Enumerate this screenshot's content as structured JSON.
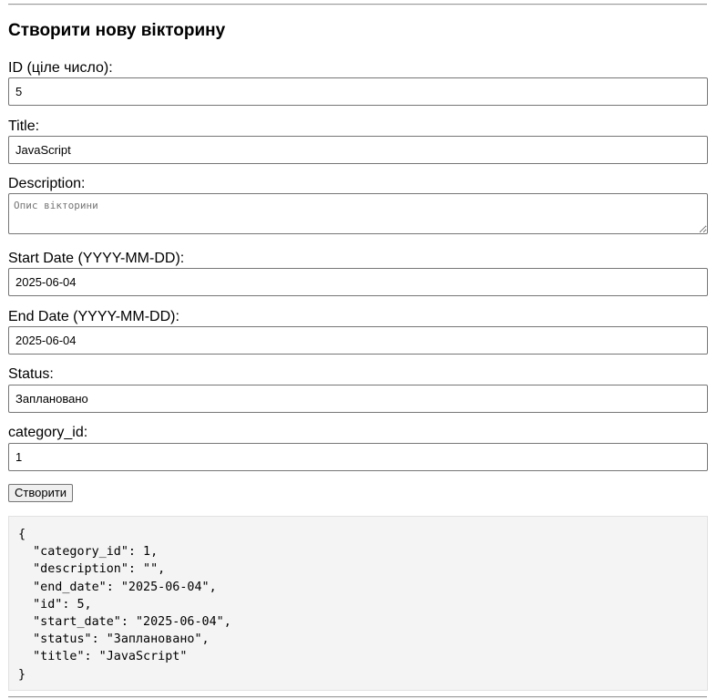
{
  "heading": "Створити нову вікторину",
  "fields": {
    "id": {
      "label": "ID (ціле число):",
      "value": "5"
    },
    "title": {
      "label": "Title:",
      "value": "JavaScript"
    },
    "description": {
      "label": "Description:",
      "value": "",
      "placeholder": "Опис вікторини"
    },
    "start_date": {
      "label": "Start Date (YYYY-MM-DD):",
      "value": "2025-06-04"
    },
    "end_date": {
      "label": "End Date (YYYY-MM-DD):",
      "value": "2025-06-04"
    },
    "status": {
      "label": "Status:",
      "value": "Заплановано"
    },
    "category_id": {
      "label": "category_id:",
      "value": "1"
    }
  },
  "submit_label": "Створити",
  "output_json": "{\n  \"category_id\": 1,\n  \"description\": \"\",\n  \"end_date\": \"2025-06-04\",\n  \"id\": 5,\n  \"start_date\": \"2025-06-04\",\n  \"status\": \"Заплановано\",\n  \"title\": \"JavaScript\"\n}"
}
